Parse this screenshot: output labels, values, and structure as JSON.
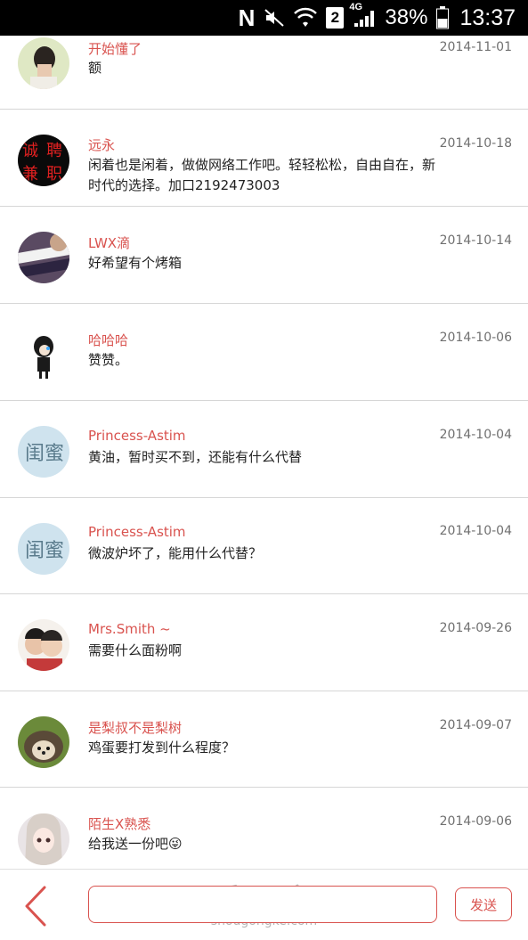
{
  "status_bar": {
    "carrier_icon": "N",
    "sim_slot": "2",
    "network": "4G",
    "battery": "38%",
    "time": "13:37"
  },
  "comments": [
    {
      "user": "开始懂了",
      "date": "2014-11-01",
      "text": "额",
      "avatar_icon": "girl-avatar-icon"
    },
    {
      "user": "远永",
      "date": "2014-10-18",
      "text": "闲着也是闲着，做做网络工作吧。轻轻松松，自由自在，新时代的选择。加口2192473003",
      "avatar_icon": "recruitment-ad-avatar-icon"
    },
    {
      "user": "LWX滴",
      "date": "2014-10-14",
      "text": "好希望有个烤箱",
      "avatar_icon": "scarf-avatar-icon"
    },
    {
      "user": "哈哈哈",
      "date": "2014-10-06",
      "text": "赞赞。",
      "avatar_icon": "anime-character-avatar-icon"
    },
    {
      "user": "Princess-Astim",
      "date": "2014-10-04",
      "text": "黄油，暂时买不到，还能有什么代替",
      "avatar_icon": "calligraphy-avatar-icon"
    },
    {
      "user": "Princess-Astim",
      "date": "2014-10-04",
      "text": "微波炉坏了，能用什么代替？",
      "avatar_icon": "calligraphy-avatar-icon"
    },
    {
      "user": "Mrs.Smith ~",
      "date": "2014-09-26",
      "text": "需要什么面粉啊",
      "avatar_icon": "couple-avatar-icon"
    },
    {
      "user": "是梨叔不是梨树",
      "date": "2014-09-07",
      "text": "鸡蛋要打发到什么程度？",
      "avatar_icon": "hedgehog-avatar-icon"
    },
    {
      "user": "陌生X熟悉",
      "date": "2014-09-06",
      "text": "给我送一份吧",
      "emoji": "😜",
      "avatar_icon": "anime-girl-avatar-icon"
    }
  ],
  "bottom_bar": {
    "input_placeholder": "",
    "send_label": "发送",
    "watermark_main": "手工客",
    "watermark_sub": "shougongke.com"
  },
  "colors": {
    "accent": "#d9534f",
    "date": "#707070",
    "divider": "#d6d6d6"
  }
}
